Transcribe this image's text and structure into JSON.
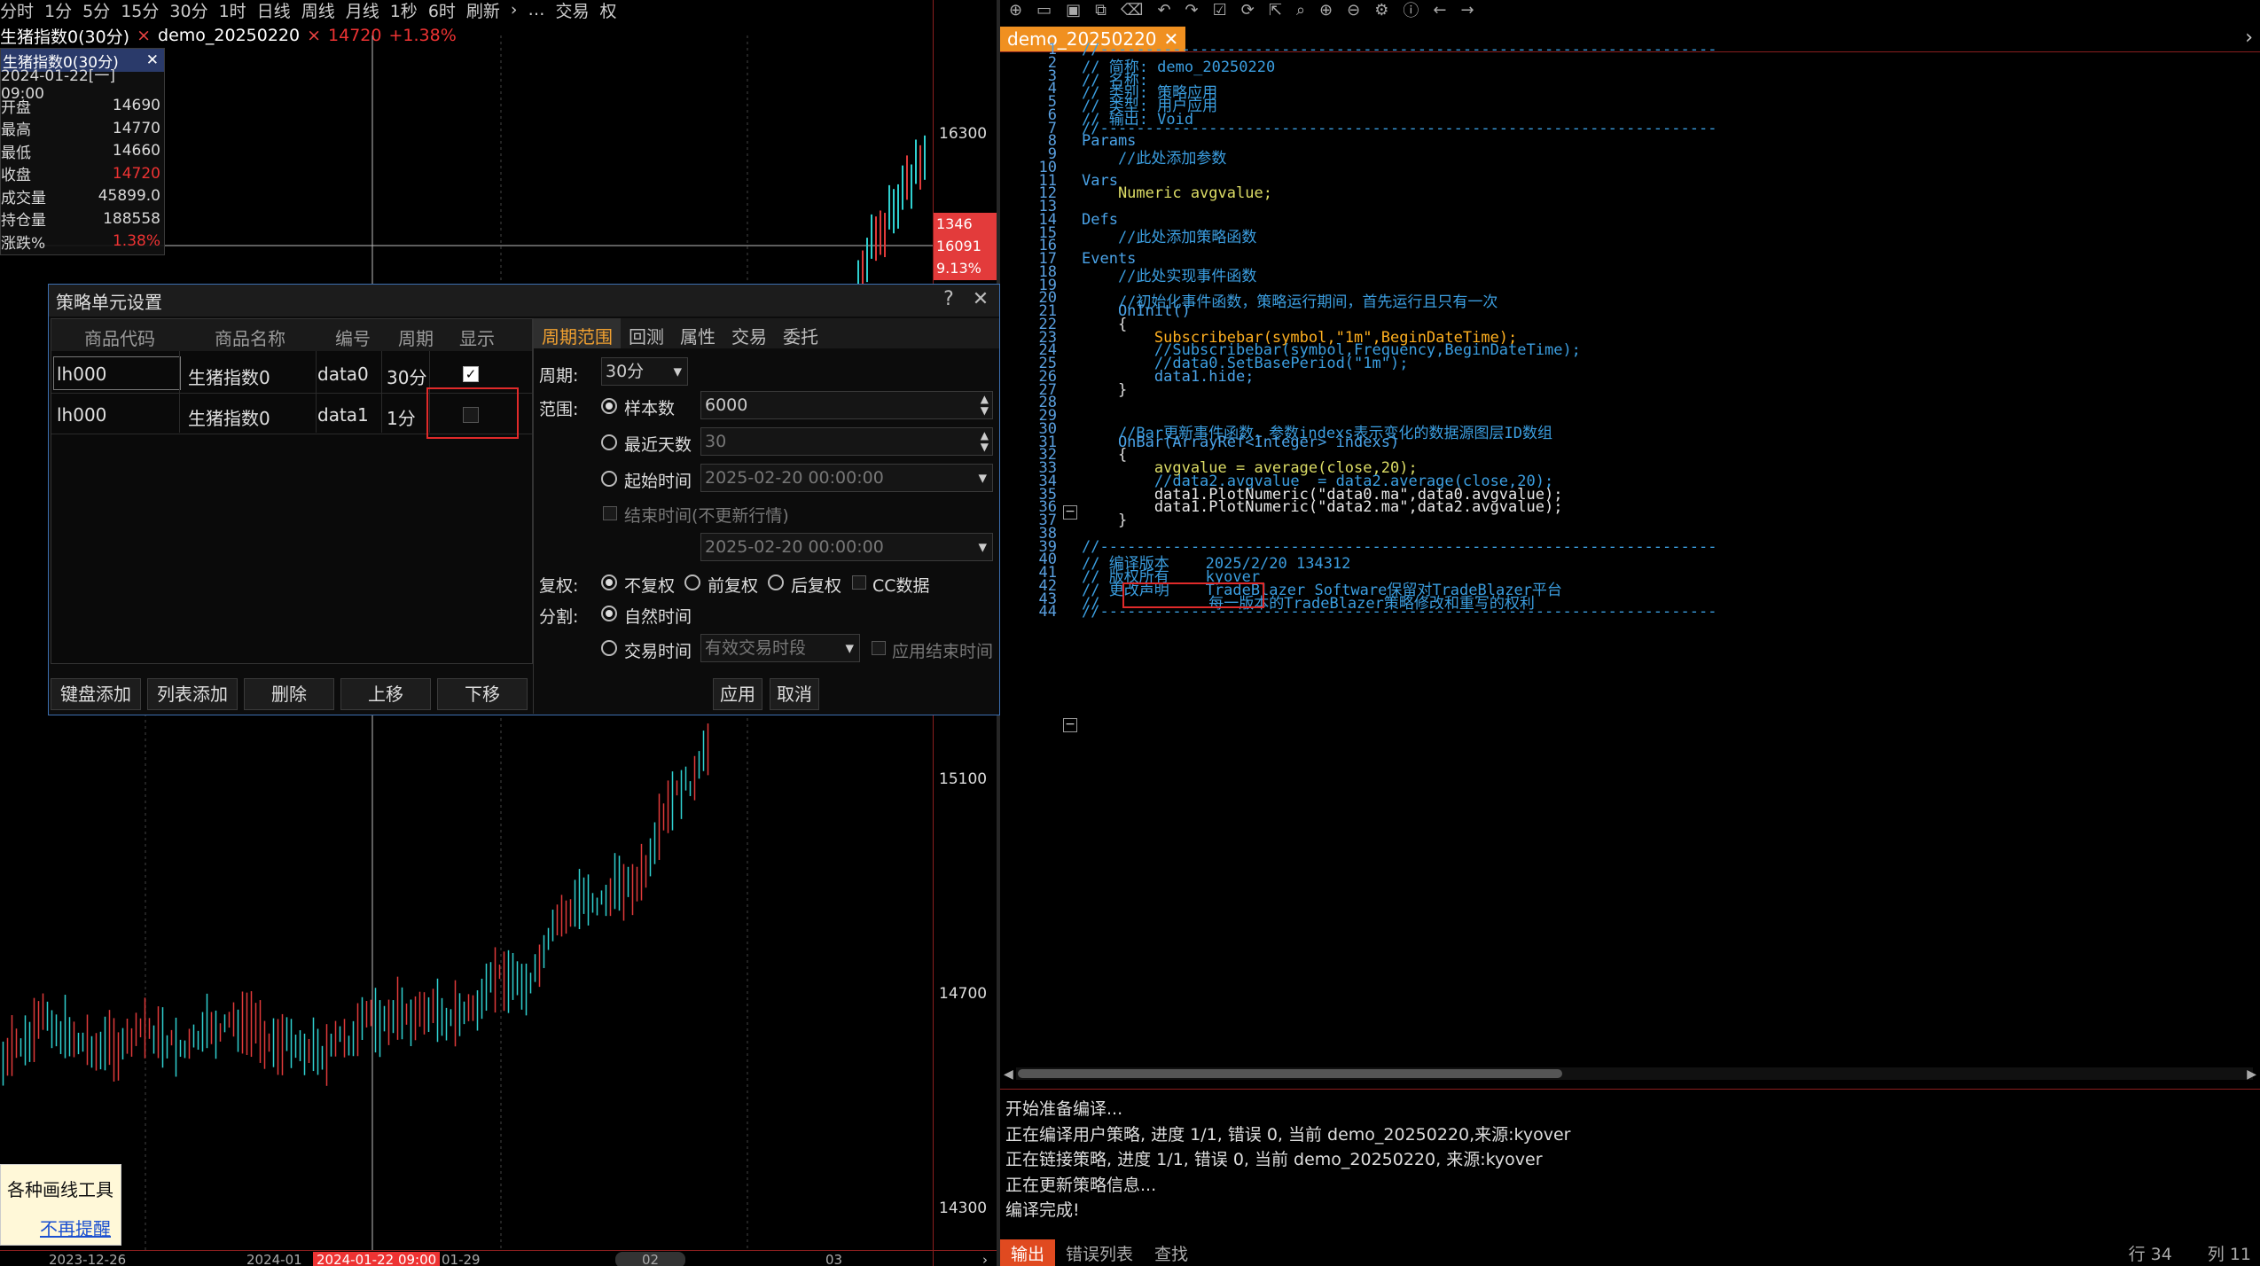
{
  "left_toolbar": [
    "分时",
    "1分",
    "5分",
    "15分",
    "30分",
    "1时",
    "日线",
    "周线",
    "月线",
    "1秒",
    "6时",
    "刷新",
    "›",
    "…",
    "交易",
    "权"
  ],
  "legend": {
    "series1": "生猪指数0(30分)",
    "series2": "demo_20250220",
    "price": "14720",
    "change": "+1.38%"
  },
  "ohlc": {
    "title": "生猪指数0(30分)",
    "rows": [
      {
        "label": "2024-01-22[一] 09:00",
        "value": ""
      },
      {
        "label": "开盘",
        "value": "14690"
      },
      {
        "label": "最高",
        "value": "14770"
      },
      {
        "label": "最低",
        "value": "14660"
      },
      {
        "label": "收盘",
        "value": "14720"
      },
      {
        "label": "成交量",
        "value": "45899.0"
      },
      {
        "label": "持仓量",
        "value": "188558"
      },
      {
        "label": "涨跌%",
        "value": "1.38%"
      }
    ]
  },
  "price_axis": {
    "ticks": [
      "16300",
      "15100",
      "14700",
      "14300"
    ],
    "tag": [
      "1346",
      "16091",
      "9.13%"
    ]
  },
  "time_axis": [
    "2023-12-26",
    "2024-01",
    "2024-01-22 09:00",
    "01-29",
    "02",
    "03"
  ],
  "hint": {
    "title": "各种画线工具",
    "link": "不再提醒"
  },
  "dialog": {
    "title": "策略单元设置",
    "grid_headers": [
      "商品代码",
      "商品名称",
      "编号",
      "周期",
      "显示"
    ],
    "rows": [
      {
        "code": "lh000",
        "name": "生猪指数0",
        "id": "data0",
        "period": "30分",
        "show": "✓"
      },
      {
        "code": "lh000",
        "name": "生猪指数0",
        "id": "data1",
        "period": "1分",
        "show": ""
      }
    ],
    "buttons": [
      "键盘添加",
      "列表添加",
      "删除",
      "上移",
      "下移"
    ],
    "tabs": [
      "周期范围",
      "回测",
      "属性",
      "交易",
      "委托"
    ],
    "period_label": "周期:",
    "period_value": "30分",
    "range_label": "范围:",
    "opt_samples": "样本数",
    "samples_value": "6000",
    "opt_recent": "最近天数",
    "recent_value": "30",
    "opt_start": "起始时间",
    "start_value": "2025-02-20 00:00:00",
    "opt_end": "结束时间(不更新行情)",
    "end_value": "2025-02-20 00:00:00",
    "adj_label": "复权:",
    "adj_none": "不复权",
    "adj_fwd": "前复权",
    "adj_back": "后复权",
    "adj_cc": "CC数据",
    "split_label": "分割:",
    "split_natural": "自然时间",
    "split_trade": "交易时间",
    "split_trade_value": "有效交易时段",
    "apply_end": "应用结束时间",
    "apply": "应用",
    "cancel": "取消"
  },
  "editor": {
    "file_tab": "demo_20250220",
    "lines": [
      {
        "n": "1",
        "t": "//--------------------------------------------------------------------",
        "c": "cm"
      },
      {
        "n": "2",
        "t": "// 简称: demo_20250220",
        "c": "cm"
      },
      {
        "n": "3",
        "t": "// 名称:",
        "c": "cm"
      },
      {
        "n": "4",
        "t": "// 类别: 策略应用",
        "c": "cm"
      },
      {
        "n": "5",
        "t": "// 类型: 用户应用",
        "c": "cm"
      },
      {
        "n": "6",
        "t": "// 输出: Void",
        "c": "cm"
      },
      {
        "n": "7",
        "t": "//--------------------------------------------------------------------",
        "c": "cm"
      },
      {
        "n": "8",
        "t": "Params",
        "c": "kw"
      },
      {
        "n": "9",
        "t": "    //此处添加参数",
        "c": "cm"
      },
      {
        "n": "10",
        "t": "",
        "c": "pl"
      },
      {
        "n": "11",
        "t": "Vars",
        "c": "kw"
      },
      {
        "n": "12",
        "t": "    Numeric avgvalue;",
        "c": "def"
      },
      {
        "n": "13",
        "t": "",
        "c": "pl"
      },
      {
        "n": "14",
        "t": "Defs",
        "c": "kw"
      },
      {
        "n": "15",
        "t": "    //此处添加策略函数",
        "c": "cm"
      },
      {
        "n": "16",
        "t": "",
        "c": "pl"
      },
      {
        "n": "17",
        "t": "Events",
        "c": "kw"
      },
      {
        "n": "18",
        "t": "    //此处实现事件函数",
        "c": "cm"
      },
      {
        "n": "19",
        "t": "",
        "c": "pl"
      },
      {
        "n": "20",
        "t": "    //初始化事件函数，策略运行期间，首先运行且只有一次",
        "c": "cm"
      },
      {
        "n": "21",
        "t": "    OnInit()",
        "c": "kw"
      },
      {
        "n": "22",
        "t": "    {",
        "c": "pl"
      },
      {
        "n": "23",
        "t": "        Subscribebar(symbol,\"1m\",BeginDateTime);",
        "c": "fn"
      },
      {
        "n": "24",
        "t": "        //Subscribebar(symbol,Frequency,BeginDateTime);",
        "c": "cm"
      },
      {
        "n": "25",
        "t": "        //data0.SetBasePeriod(\"1m\");",
        "c": "cm"
      },
      {
        "n": "26",
        "t": "        data1.hide;",
        "c": "kw"
      },
      {
        "n": "27",
        "t": "    }",
        "c": "pl"
      },
      {
        "n": "28",
        "t": "",
        "c": "pl"
      },
      {
        "n": "29",
        "t": "",
        "c": "pl"
      },
      {
        "n": "30",
        "t": "    //Bar更新事件函数，参数indexs表示变化的数据源图层ID数组",
        "c": "cm"
      },
      {
        "n": "31",
        "t": "    OnBar(ArrayRef<Integer> indexs)",
        "c": "kw"
      },
      {
        "n": "32",
        "t": "    {",
        "c": "pl"
      },
      {
        "n": "33",
        "t": "        avgvalue = average(close,20);",
        "c": "def"
      },
      {
        "n": "34",
        "t": "        //data2.avgvalue  = data2.average(close,20);",
        "c": "cm"
      },
      {
        "n": "35",
        "t": "        data1.PlotNumeric(\"data0.ma\",data0.avgvalue);",
        "c": "str"
      },
      {
        "n": "36",
        "t": "        data1.PlotNumeric(\"data2.ma\",data2.avgvalue);",
        "c": "str"
      },
      {
        "n": "37",
        "t": "    }",
        "c": "pl"
      },
      {
        "n": "38",
        "t": "",
        "c": "pl"
      },
      {
        "n": "39",
        "t": "//--------------------------------------------------------------------",
        "c": "cm"
      },
      {
        "n": "40",
        "t": "// 编译版本    2025/2/20 134312",
        "c": "cm"
      },
      {
        "n": "41",
        "t": "// 版权所有    kyover",
        "c": "cm"
      },
      {
        "n": "42",
        "t": "// 更改声明    TradeBlazer Software保留对TradeBlazer平台",
        "c": "cm"
      },
      {
        "n": "43",
        "t": "//            每一版本的TradeBlazer策略修改和重写的权利",
        "c": "cm"
      },
      {
        "n": "44",
        "t": "//--------------------------------------------------------------------",
        "c": "cm"
      }
    ]
  },
  "output": [
    "开始准备编译...",
    "正在编译用户策略, 进度 1/1, 错误 0, 当前 demo_20250220,来源:kyover",
    "正在链接策略, 进度 1/1, 错误 0, 当前 demo_20250220, 来源:kyover",
    "正在更新策略信息...",
    "编译完成!"
  ],
  "bottom_tabs": [
    "输出",
    "错误列表",
    "查找"
  ],
  "status": {
    "row": "行 34",
    "col": "列 11"
  }
}
